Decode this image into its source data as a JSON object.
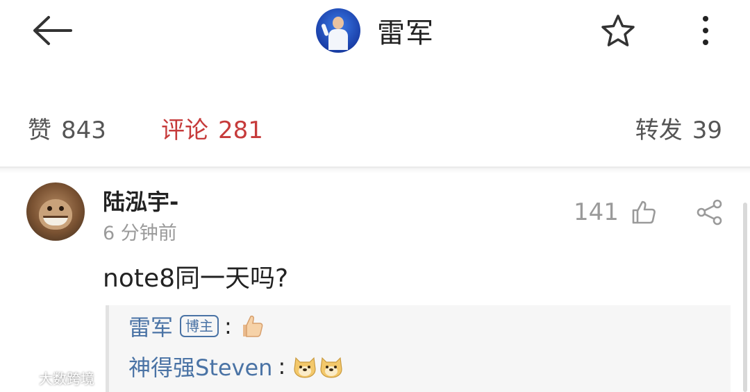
{
  "header": {
    "title": "雷军",
    "icons": {
      "back": "arrow-left-icon",
      "favorite": "star-icon",
      "more": "more-vertical-icon"
    }
  },
  "stats": {
    "likes_label": "赞",
    "likes_count": "843",
    "comments_label": "评论",
    "comments_count": "281",
    "reposts_label": "转发",
    "reposts_count": "39",
    "active_color": "#c63b3b"
  },
  "comment": {
    "author": "陆泓宇-",
    "time": "6 分钟前",
    "like_count": "141",
    "text": "note8同一天吗?",
    "icons": {
      "like": "thumbs-up-icon",
      "share": "share-icon"
    },
    "replies": [
      {
        "name": "雷军",
        "badge": "博主",
        "colon": ":",
        "emoji": [
          "thumbs-up-emoji"
        ]
      },
      {
        "name": "神得强Steven",
        "colon": ":",
        "emoji": [
          "doge-emoji",
          "doge-emoji"
        ]
      }
    ]
  },
  "watermark": {
    "text": "大数跨境"
  },
  "colors": {
    "link": "#4a73a5",
    "muted": "#9a9a9a",
    "text": "#222222"
  }
}
